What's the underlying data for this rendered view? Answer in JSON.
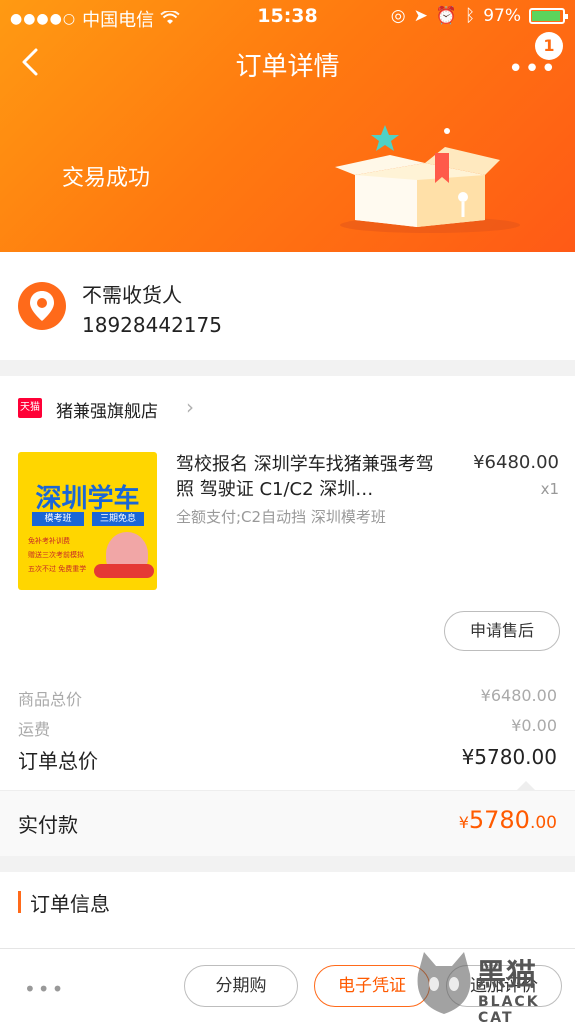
{
  "status_bar": {
    "carrier": "中国电信",
    "time": "15:38",
    "battery": "97%"
  },
  "nav": {
    "title": "订单详情",
    "badge_count": "1",
    "more": "•••"
  },
  "trade": {
    "status": "交易成功"
  },
  "address": {
    "receiver": "不需收货人",
    "phone": "18928442175"
  },
  "shop": {
    "badge": "天猫",
    "name": "猪兼强旗舰店"
  },
  "product": {
    "thumb_title": "深圳学车",
    "thumb_tag_1": "模考班",
    "thumb_tag_2": "三期免息",
    "thumb_features": [
      "免补考补训费",
      "赠送三次考前模拟",
      "五次不过 免费重学"
    ],
    "title": "驾校报名 深圳学车找猪兼强考驾照 驾驶证 C1/C2 深圳…",
    "spec": "全额支付;C2自动挡 深圳模考班",
    "price": "¥6480.00",
    "qty": "x1"
  },
  "actions": {
    "after_sale": "申请售后"
  },
  "summary": {
    "goods_total_label": "商品总价",
    "goods_total_value": "¥6480.00",
    "shipping_label": "运费",
    "shipping_value": "¥0.00",
    "order_total_label": "订单总价",
    "order_total_value": "¥5780.00"
  },
  "paid": {
    "label": "实付款",
    "currency": "¥",
    "amount_int": "5780",
    "amount_dec": ".00"
  },
  "order_info": {
    "title": "订单信息"
  },
  "bottom_bar": {
    "more": "•••",
    "installment": "分期购",
    "voucher": "电子凭证",
    "review": "追加评价"
  },
  "watermark": {
    "title": "黑猫",
    "subtitle": "BLACK CAT"
  },
  "colors": {
    "accent": "#ff6a1a",
    "price_red": "#ff5a00",
    "tmall_red": "#ff0036"
  }
}
